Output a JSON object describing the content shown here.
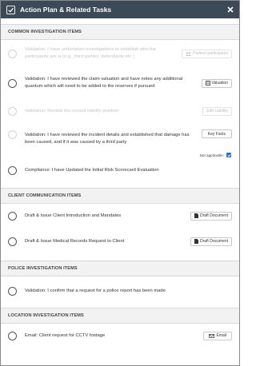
{
  "header": {
    "title": "Action Plan & Related Tasks"
  },
  "sections": [
    {
      "title": "COMMON INVESTIGATION ITEMS",
      "items": [
        {
          "text": "Validation: I have undertaken investigations to establish who the participants are is (e.g., third parties, defendants etc.)",
          "button": "Parties/ participants",
          "enabled": false
        },
        {
          "text": "Validation: I have reviewed the claim valuation and have notes any additional quantum which will need to be added to the reserves if pursued",
          "button": "Valuation",
          "enabled": true
        },
        {
          "text": "Validation: Review the current liability position",
          "button": "Edit Liability",
          "enabled": false
        },
        {
          "text": "Validation: I have reviewed the incident details and established that damage has been caused, and if it was caused by a third party",
          "button": "Key Facts",
          "enabled": false,
          "not_applicable_label": "Not applicable:",
          "not_applicable": true
        },
        {
          "text": "Compliance: I have Updated the Initial Risk Scorecard Evaluation",
          "enabled": true
        }
      ]
    },
    {
      "title": "CLIENT COMMUNICATION ITEMS",
      "items": [
        {
          "text": "Draft & Issue Client Introduction and Mandates",
          "button": "Draft Document",
          "enabled": true
        },
        {
          "text": "Draft & Issue Medical Records Request to Client",
          "button": "Draft Document",
          "enabled": true
        }
      ]
    },
    {
      "title": "POLICE INVESTIGATION ITEMS",
      "items": [
        {
          "text": "Validation: I confirm that a request for a police report has been made",
          "enabled": true
        }
      ]
    },
    {
      "title": "LOCATION INVESTIGATION ITEMS",
      "items": [
        {
          "text": "Email: Client request for CCTV footage",
          "button": "Email",
          "enabled": true
        }
      ]
    }
  ],
  "colors": {
    "titlebar": "#3c4a57",
    "section_bg": "#f2f2f2",
    "checkbox": "#2f6fc8"
  },
  "icons": [
    "check-icon",
    "close-icon",
    "users-icon",
    "calculator-icon",
    "document-icon",
    "envelope-icon"
  ]
}
